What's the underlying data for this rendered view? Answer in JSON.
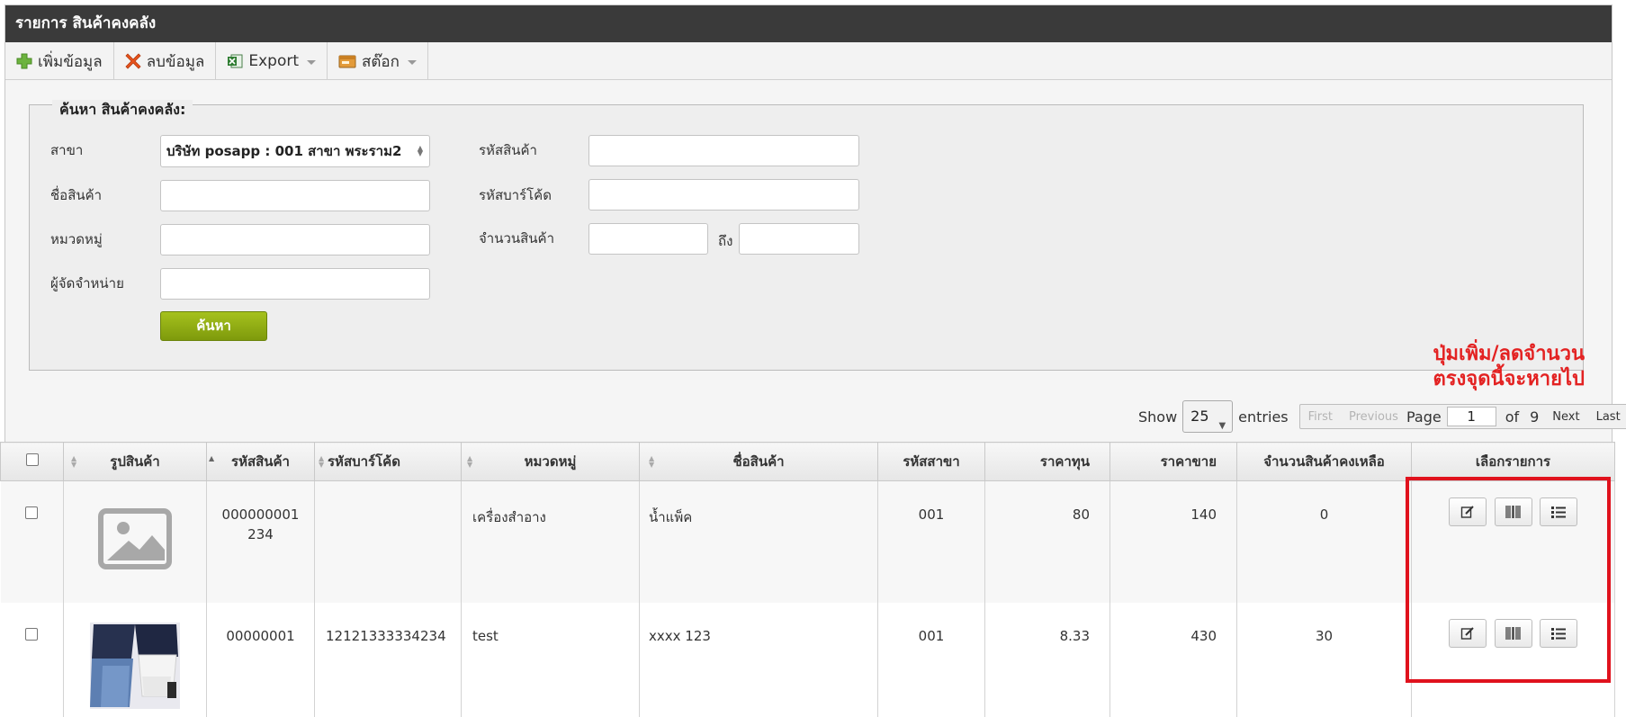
{
  "window": {
    "title": "รายการ สินค้าคงคลัง"
  },
  "toolbar": {
    "add_label": "เพิ่มข้อมูล",
    "delete_label": "ลบข้อมูล",
    "export_label": "Export",
    "stock_label": "สต๊อก"
  },
  "search": {
    "legend": "ค้นหา สินค้าคงคลัง:",
    "branch_label": "สาขา",
    "branch_value": "บริษัท posapp : 001 สาขา พระราม2",
    "name_label": "ชื่อสินค้า",
    "category_label": "หมวดหมู่",
    "supplier_label": "ผู้จัดจำหน่าย",
    "code_label": "รหัสสินค้า",
    "barcode_label": "รหัสบาร์โค้ด",
    "qty_label": "จำนวนสินค้า",
    "qty_to_label": "ถึง",
    "button_label": "ค้นหา"
  },
  "note": {
    "line1": "ปุ่มเพิ่ม/ลดจำนวน",
    "line2": "ตรงจุดนี้จะหายไป"
  },
  "pager": {
    "show_label": "Show",
    "entries_value": "25",
    "entries_label": "entries",
    "first": "First",
    "previous": "Previous",
    "page_label": "Page",
    "page_value": "1",
    "of_label": "of",
    "total_pages": "9",
    "next": "Next",
    "last": "Last"
  },
  "table": {
    "columns": [
      "รูปสินค้า",
      "รหัสสินค้า",
      "รหัสบาร์โค้ด",
      "หมวดหมู่",
      "ชื่อสินค้า",
      "รหัสสาขา",
      "ราคาทุน",
      "ราคาขาย",
      "จำนวนสินค้าคงเหลือ",
      "เลือกรายการ"
    ],
    "rows": [
      {
        "code": "000000001234",
        "barcode": "",
        "category": "เครื่องสำอาง",
        "name": "น้ำแพ็ค",
        "branch": "001",
        "cost": "80",
        "price": "140",
        "stock": "0"
      },
      {
        "code": "00000001",
        "barcode": "12121333334234",
        "category": "test",
        "name": "xxxx 123",
        "branch": "001",
        "cost": "8.33",
        "price": "430",
        "stock": "30"
      }
    ]
  },
  "icons": {
    "add": "plus-icon",
    "delete": "x-icon",
    "export": "excel-icon",
    "stock": "wallet-icon",
    "edit": "edit-icon",
    "barcode": "barcode-icon",
    "list": "list-icon"
  },
  "colors": {
    "title_bar": "#3a3a3a",
    "search_button": "#8fad14",
    "note": "#e32222",
    "highlight_box": "#e0121d"
  }
}
